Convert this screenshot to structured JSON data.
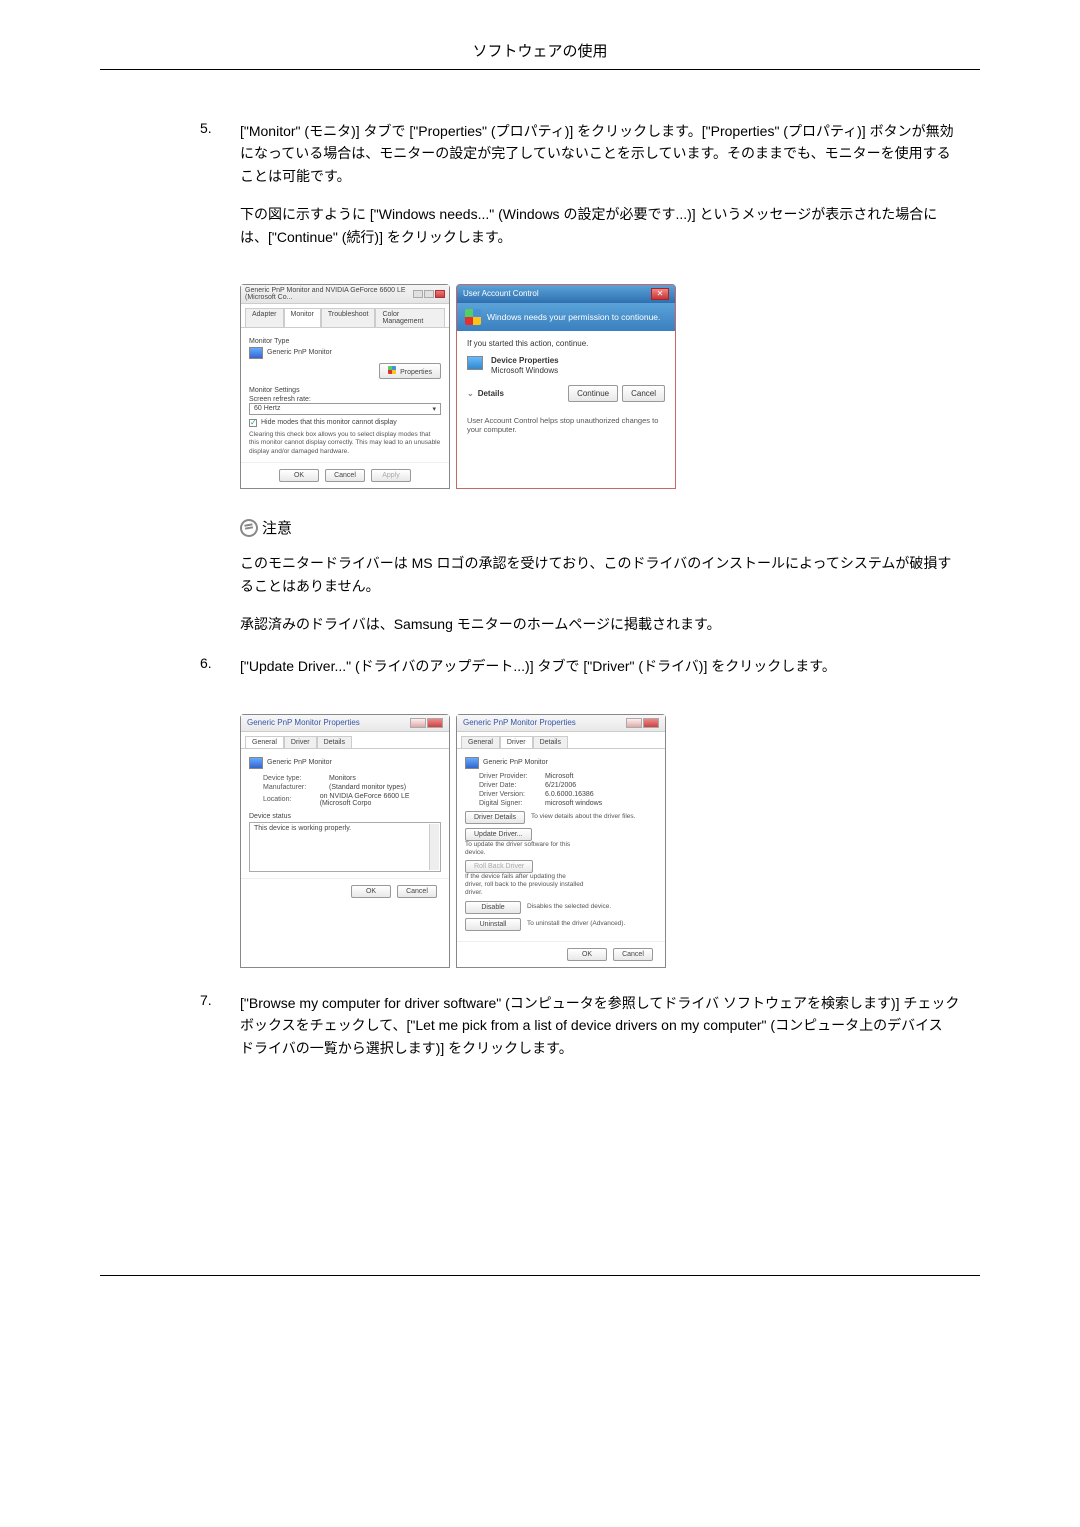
{
  "header": {
    "title": "ソフトウェアの使用"
  },
  "step5": {
    "num": "5.",
    "p1": "[\"Monitor\" (モニタ)] タブで [\"Properties\" (プロパティ)] をクリックします。[\"Properties\" (プロパティ)] ボタンが無効になっている場合は、モニターの設定が完了していないことを示しています。そのままでも、モニターを使用することは可能です。",
    "p2": "下の図に示すように [\"Windows needs...\" (Windows の設定が必要です...)] というメッセージが表示された場合には、[\"Continue\" (続行)] をクリックします。"
  },
  "monitorDialog": {
    "title": "Generic PnP Monitor and NVIDIA GeForce 6600 LE (Microsoft Co...",
    "tabs": {
      "adapter": "Adapter",
      "monitor": "Monitor",
      "troubleshoot": "Troubleshoot",
      "color": "Color Management"
    },
    "monitorType": "Monitor Type",
    "monitorName": "Generic PnP Monitor",
    "propertiesBtn": "Properties",
    "monitorSettings": "Monitor Settings",
    "refreshLabel": "Screen refresh rate:",
    "refreshValue": "60 Hertz",
    "hideModes": "Hide modes that this monitor cannot display",
    "hideHint": "Clearing this check box allows you to select display modes that this monitor cannot display correctly. This may lead to an unusable display and/or damaged hardware.",
    "ok": "OK",
    "cancel": "Cancel",
    "apply": "Apply"
  },
  "uac": {
    "title": "User Account Control",
    "banner": "Windows needs your permission to contionue.",
    "ifStarted": "If you started this action, continue.",
    "devProps": "Device Properties",
    "msWindows": "Microsoft Windows",
    "details": "Details",
    "continue": "Continue",
    "cancel": "Cancel",
    "footer": "User Account Control helps stop unauthorized changes to your computer."
  },
  "note": {
    "label": "注意",
    "p1": "このモニタードライバーは MS ロゴの承認を受けており、このドライバのインストールによってシステムが破損することはありません。",
    "p2": "承認済みのドライバは、Samsung モニターのホームページに掲載されます。"
  },
  "step6": {
    "num": "6.",
    "p1": "[\"Update Driver...\" (ドライバのアップデート...)] タブで [\"Driver\" (ドライバ)] をクリックします。"
  },
  "propsLeft": {
    "title": "Generic PnP Monitor Properties",
    "tabs": {
      "general": "General",
      "driver": "Driver",
      "details": "Details"
    },
    "monitorName": "Generic PnP Monitor",
    "deviceType": "Device type:",
    "deviceTypeVal": "Monitors",
    "manufacturer": "Manufacturer:",
    "manufacturerVal": "(Standard monitor types)",
    "location": "Location:",
    "locationVal": "on NVIDIA GeForce 6600 LE (Microsoft Corpo",
    "deviceStatus": "Device status",
    "statusText": "This device is working properly.",
    "ok": "OK",
    "cancel": "Cancel"
  },
  "propsRight": {
    "title": "Generic PnP Monitor Properties",
    "tabs": {
      "general": "General",
      "driver": "Driver",
      "details": "Details"
    },
    "monitorName": "Generic PnP Monitor",
    "provider": "Driver Provider:",
    "providerVal": "Microsoft",
    "date": "Driver Date:",
    "dateVal": "6/21/2006",
    "version": "Driver Version:",
    "versionVal": "6.0.6000.16386",
    "signer": "Digital Signer:",
    "signerVal": "microsoft windows",
    "driverDetails": "Driver Details",
    "driverDetailsDesc": "To view details about the driver files.",
    "updateDriver": "Update Driver...",
    "updateDriverDesc": "To update the driver software for this device.",
    "rollBack": "Roll Back Driver",
    "rollBackDesc": "If the device fails after updating the driver, roll back to the previously installed driver.",
    "disable": "Disable",
    "disableDesc": "Disables the selected device.",
    "uninstall": "Uninstall",
    "uninstallDesc": "To uninstall the driver (Advanced).",
    "ok": "OK",
    "cancel": "Cancel"
  },
  "step7": {
    "num": "7.",
    "p1": "[\"Browse my computer for driver software\" (コンピュータを参照してドライバ ソフトウェアを検索します)] チェックボックスをチェックして、[\"Let me pick from a list of device drivers on my computer\" (コンピュータ上のデバイス ドライバの一覧から選択します)] をクリックします。"
  }
}
